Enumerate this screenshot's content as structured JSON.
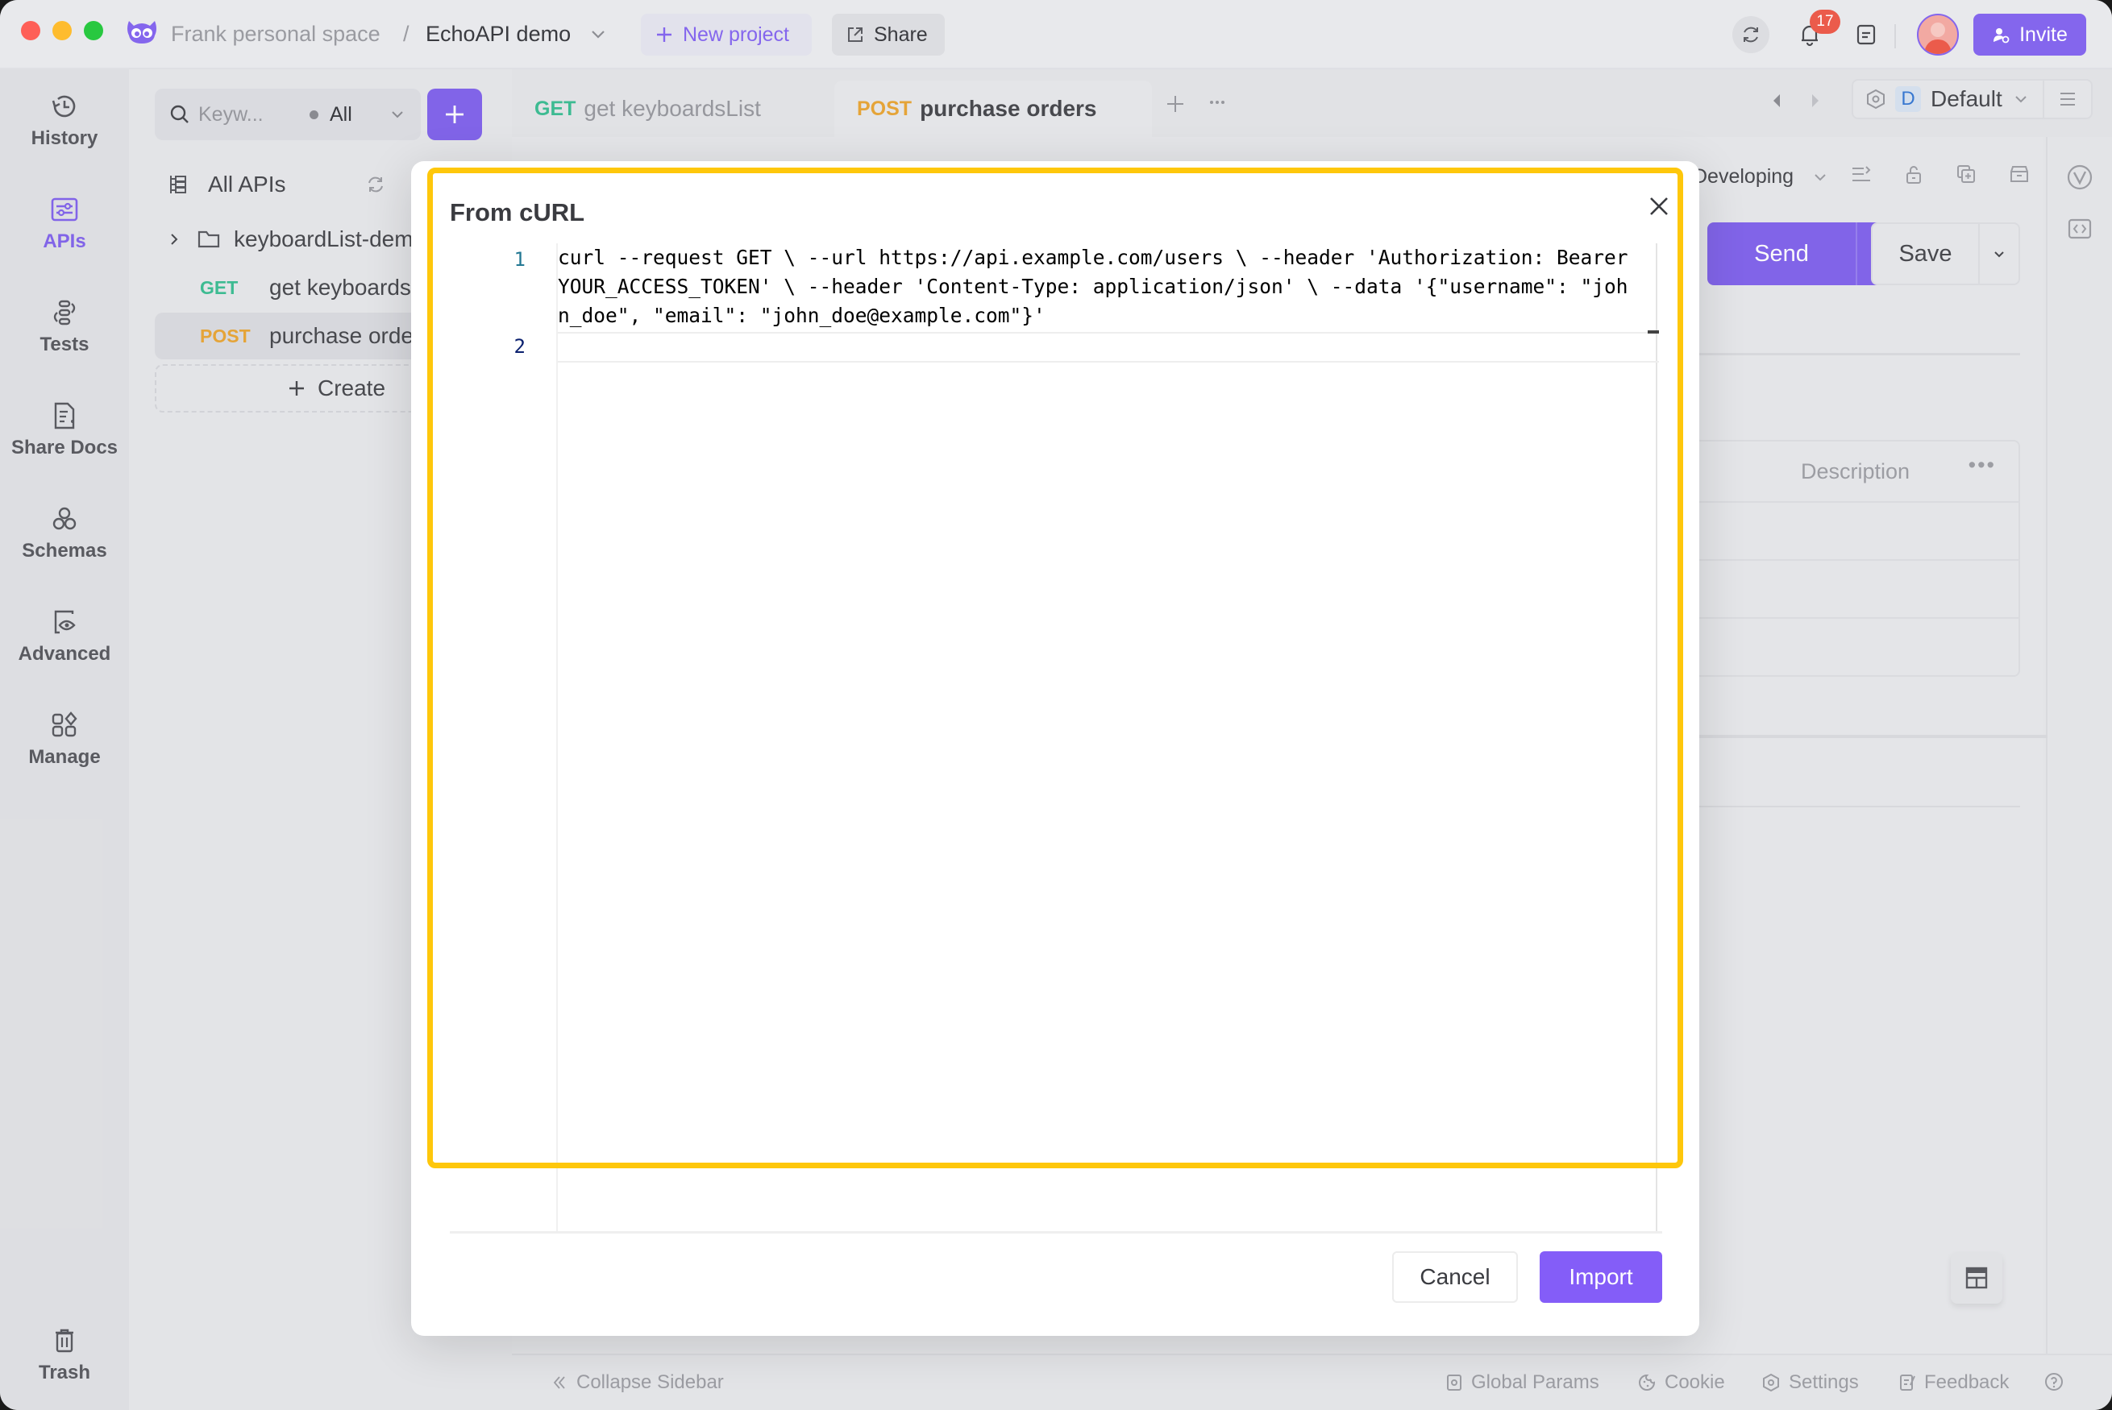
{
  "titlebar": {
    "workspace": "Frank personal space",
    "separator": "/",
    "project": "EchoAPI demo",
    "new_project_label": "New project",
    "share_label": "Share",
    "notification_count": "17",
    "invite_label": "Invite"
  },
  "leftnav": {
    "items": [
      {
        "label": "History",
        "icon": "history-icon",
        "active": false
      },
      {
        "label": "APIs",
        "icon": "apis-icon",
        "active": true
      },
      {
        "label": "Tests",
        "icon": "tests-icon",
        "active": false
      },
      {
        "label": "Share Docs",
        "icon": "share-docs-icon",
        "active": false
      },
      {
        "label": "Schemas",
        "icon": "schemas-icon",
        "active": false
      },
      {
        "label": "Advanced",
        "icon": "advanced-icon",
        "active": false
      },
      {
        "label": "Manage",
        "icon": "manage-icon",
        "active": false
      }
    ],
    "trash_label": "Trash"
  },
  "tree": {
    "search_placeholder": "Keyw...",
    "filter_value": "All",
    "all_apis_label": "All APIs",
    "folder_label": "keyboardList-demo",
    "items": [
      {
        "method": "GET",
        "name": "get keyboardsList"
      },
      {
        "method": "POST",
        "name": "purchase orders",
        "selected": true
      }
    ],
    "create_label": "Create"
  },
  "tabs": [
    {
      "method": "GET",
      "name": "get keyboardsList",
      "active": false
    },
    {
      "method": "POST",
      "name": "purchase orders",
      "active": true
    }
  ],
  "environment": {
    "badge": "D",
    "name": "Default"
  },
  "request": {
    "status": "Developing",
    "send_label": "Send",
    "save_label": "Save",
    "table_header_description": "Description",
    "table_header_more": "•••"
  },
  "footer": {
    "collapse_label": "Collapse Sidebar",
    "global_params_label": "Global Params",
    "cookie_label": "Cookie",
    "settings_label": "Settings",
    "feedback_label": "Feedback"
  },
  "dialog": {
    "title": "From cURL",
    "line_numbers": [
      "1",
      "2"
    ],
    "code_line_1": "curl --request GET \\ --url https://api.example.com/users \\ --header 'Authorization: Bearer YOUR_ACCESS_TOKEN' \\ --header 'Content-Type: application/json' \\ --data '{\"username\": \"john_doe\", \"email\": \"john_doe@example.com\"}'",
    "code_line_2": "",
    "cancel_label": "Cancel",
    "import_label": "Import"
  },
  "colors": {
    "accent": "#8466ed",
    "get": "#3fbf95",
    "post": "#eaa83a",
    "highlight": "#fec70b",
    "badge": "#eb5b4b"
  }
}
